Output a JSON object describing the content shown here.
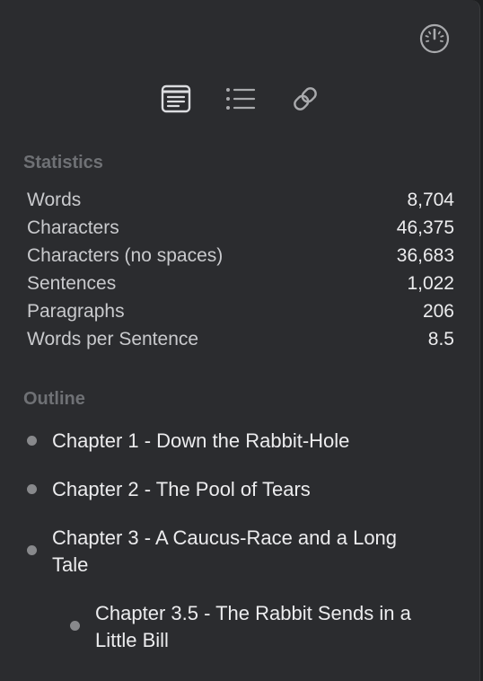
{
  "toolbar": {
    "gauge_icon": "gauge-icon",
    "tabs": [
      {
        "icon": "document-icon",
        "selected": true
      },
      {
        "icon": "list-icon",
        "selected": false
      },
      {
        "icon": "link-icon",
        "selected": false
      }
    ]
  },
  "statistics": {
    "heading": "Statistics",
    "rows": [
      {
        "label": "Words",
        "value": "8,704"
      },
      {
        "label": "Characters",
        "value": "46,375"
      },
      {
        "label": "Characters (no spaces)",
        "value": "36,683"
      },
      {
        "label": "Sentences",
        "value": "1,022"
      },
      {
        "label": "Paragraphs",
        "value": "206"
      },
      {
        "label": "Words per Sentence",
        "value": "8.5"
      }
    ]
  },
  "outline": {
    "heading": "Outline",
    "items": [
      {
        "text": "Chapter 1 - Down the Rabbit-Hole",
        "level": 1
      },
      {
        "text": "Chapter 2 - The Pool of Tears",
        "level": 1
      },
      {
        "text": "Chapter 3 - A Caucus-Race and a Long Tale",
        "level": 1
      },
      {
        "text": "Chapter 3.5 - The Rabbit Sends in a Little Bill",
        "level": 2
      }
    ]
  },
  "colors": {
    "panel_bg": "#2b2c2f",
    "heading": "#6f7175",
    "label": "#c9cacd",
    "value": "#ececee",
    "icon": "#a9aaad"
  }
}
